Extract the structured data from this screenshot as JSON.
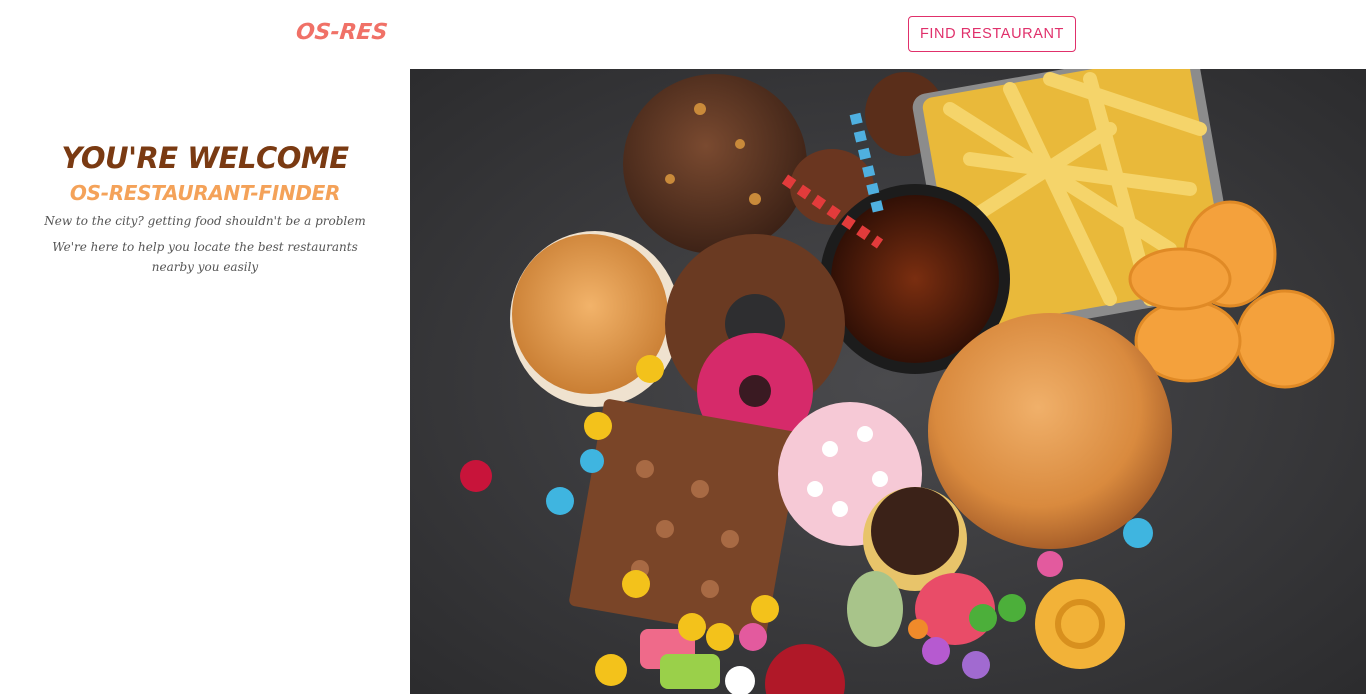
{
  "navbar": {
    "brand": "OS-RES",
    "find_button": "FIND RESTAURANT"
  },
  "welcome": {
    "heading": "YOU'RE WELCOME",
    "subheading": "OS-RESTAURANT-FINDER",
    "line1": "New to the city? getting food shouldn't be a problem",
    "line2": "We're here to help you locate the best restaurants nearby you easily"
  },
  "colors": {
    "brand": "#f07167",
    "button": "#e0306b",
    "heading": "#7a3a12",
    "subheading": "#f4a259",
    "hero_background": "#3a3a3c"
  }
}
